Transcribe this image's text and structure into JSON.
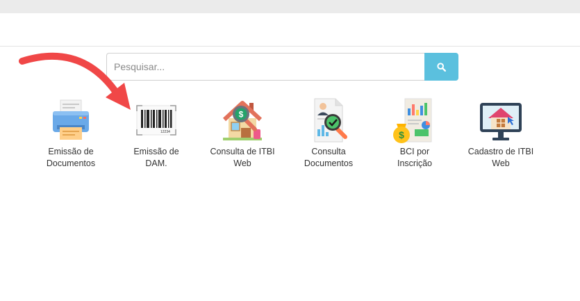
{
  "search": {
    "placeholder": "Pesquisar..."
  },
  "tiles": [
    {
      "label": "Emissão de\nDocumentos",
      "icon": "printer-icon"
    },
    {
      "label": "Emissão de\nDAM.",
      "icon": "barcode-icon"
    },
    {
      "label": "Consulta de ITBI\nWeb",
      "icon": "house-dollar-search-icon"
    },
    {
      "label": "Consulta\nDocumentos",
      "icon": "document-check-search-icon"
    },
    {
      "label": "BCI por\nInscrição",
      "icon": "report-money-icon"
    },
    {
      "label": "Cadastro de ITBI\nWeb",
      "icon": "monitor-house-icon"
    }
  ],
  "barcode": {
    "number": "12234"
  },
  "colors": {
    "search_button": "#5bc0de",
    "annotation_arrow": "#f04747"
  }
}
